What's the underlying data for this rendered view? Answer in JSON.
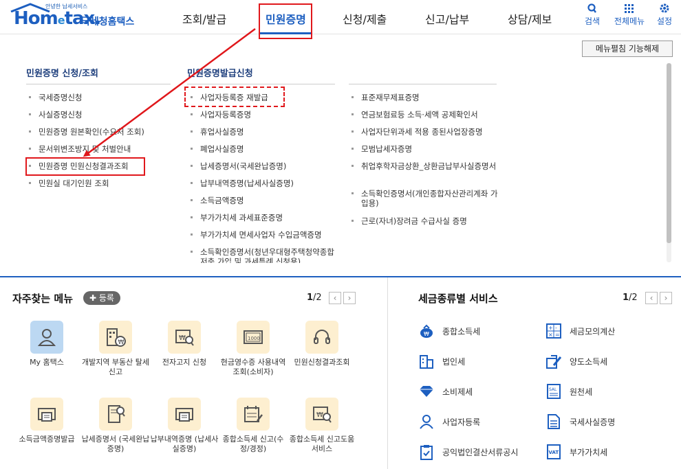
{
  "logo": {
    "small": "안녕한 납세서비스",
    "main_a": "Hom",
    "main_e": "e",
    "main_b": "tax.",
    "sub": "국세청홈택스"
  },
  "gnb": [
    "조회/발급",
    "민원증명",
    "신청/제출",
    "신고/납부",
    "상담/제보"
  ],
  "util": [
    {
      "label": "검색",
      "icon": "search-icon"
    },
    {
      "label": "전체메뉴",
      "icon": "grid-icon"
    },
    {
      "label": "설정",
      "icon": "gear-icon"
    }
  ],
  "fold_button": "메뉴펼침 기능해제",
  "menu": {
    "col1_title": "민원증명 신청/조회",
    "col1": [
      "국세증명신청",
      "사실증명신청",
      "민원증명 원본확인(수요처 조회)",
      "문서위변조방지 및 처벌안내",
      "민원증명 민원신청결과조회",
      "민원실 대기인원 조회"
    ],
    "col2_title": "민원증명발급신청",
    "col2": [
      "사업자등록증 재발급",
      "사업자등록증명",
      "휴업사실증명",
      "폐업사실증명",
      "납세증명서(국세완납증명)",
      "납부내역증명(납세사실증명)",
      "소득금액증명",
      "부가가치세 과세표준증명",
      "부가가치세 면세사업자 수입금액증명",
      "소득확인증명서(청년우대형주택청약종합저축 가입 및 과세특례 신청용)"
    ],
    "col3": [
      "표준재무제표증명",
      "연금보험료등 소득·세액 공제확인서",
      "사업자단위과세 적용 종된사업장증명",
      "모범납세자증명",
      "취업후학자금상환_상환금납부사실증명서",
      "소득확인증명서(개인종합자산관리계좌 가입용)",
      "근로(자녀)장려금 수급사실 증명"
    ]
  },
  "favorites": {
    "title": "자주찾는 메뉴",
    "register": "등록",
    "page_current": "1",
    "page_total": "/2",
    "row1": [
      "My 홈택스",
      "개발지역 부동산 탈세신고",
      "전자고지 신청",
      "현금영수증 사용내역조회(소비자)",
      "민원신청결과조회"
    ],
    "row2": [
      "소득금액증명발급",
      "납세증명서 (국세완납증명)",
      "납부내역증명 (납세사실증명)",
      "종합소득세 신고(수정/경정)",
      "종합소득세 신고도움 서비스"
    ]
  },
  "services": {
    "title": "세금종류별 서비스",
    "page_current": "1",
    "page_total": "/2",
    "left": [
      "종합소득세",
      "법인세",
      "소비제세",
      "사업자등록",
      "공익법인결산서류공시"
    ],
    "right": [
      "세금모의계산",
      "양도소득세",
      "원천세",
      "국세사실증명",
      "부가가치세"
    ]
  },
  "colors": {
    "brand": "#1d5fc0",
    "annotation": "#e0171b"
  }
}
